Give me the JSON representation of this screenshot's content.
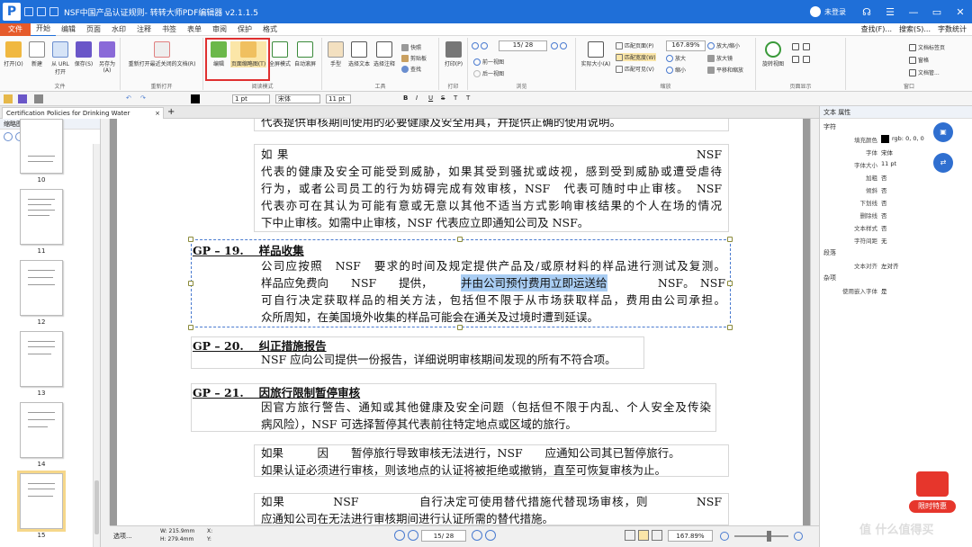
{
  "window": {
    "title": "NSF中国产品认证规则- 转转大师PDF编辑器 v2.1.1.5",
    "user": "未登录"
  },
  "menu": {
    "tabs": [
      "文件",
      "开始",
      "编辑",
      "页面",
      "水印",
      "注释",
      "书签",
      "表单",
      "审阅",
      "保护",
      "格式"
    ],
    "right": [
      "查找(F)...",
      "搜索(S)...",
      "字数统计"
    ]
  },
  "ribbon": {
    "buttons": {
      "open": "打开(O)",
      "new": "新建",
      "from_url": "从 URL 打开",
      "save": "保存(S)",
      "save_as": "另存为(A)",
      "reopen": "重新打开最近关闭的文档(R)",
      "edit": "编辑",
      "page_thumbs": "页面缩略图(T)",
      "fullscreen": "全屏模式",
      "auto_scroll": "自动滚屏",
      "hand": "手型",
      "select_text": "选择文本",
      "select_annot": "选择注释",
      "snapshot": "快照",
      "clipboard": "剪贴板",
      "find": "查找",
      "print": "打印(P)",
      "prev_view": "前一视图",
      "next_view": "后一视图",
      "actual_size": "实际大小(A)",
      "fit_page": "匹配页面(P)",
      "fit_width": "匹配宽度(W)",
      "fit_visible": "匹配可见(V)",
      "zoom": "放大/缩小",
      "zoom_in": "放大",
      "zoom_out": "缩小",
      "magnify": "放大镜",
      "pan_zoom": "平移和缩放",
      "rotate_view": "旋转视图",
      "doc_tab": "文档标签页",
      "window_menu": "窗格",
      "doc_manage": "文档管..."
    },
    "page_value": "15",
    "page_total": "/ 28",
    "zoom_value": "167.89%",
    "groups": [
      "文件",
      "重新打开",
      "阅读模式",
      "工具",
      "打印",
      "浏览",
      "缩放",
      "页面显示",
      "窗口"
    ]
  },
  "format_bar": {
    "line_width": "1 pt",
    "font": "宋体",
    "size": "11 pt",
    "styles": [
      "B",
      "I",
      "U",
      "S",
      "T",
      "T"
    ]
  },
  "doc_tab": {
    "title": "Certification Policies for Drinking Water Treatme...",
    "close": "×",
    "add": "+"
  },
  "thumbnails": {
    "panel_title": "缩略图",
    "pages": [
      "10",
      "11",
      "12",
      "13",
      "14",
      "15"
    ],
    "selected": "15"
  },
  "document": {
    "top_cut": "代表提供审核期间使用的必要健康及安全用具，并提供正确的使用说明。",
    "block1": [
      "如果　　　　　　　　　　　　　　　　　　　　　　　　　NSF",
      "代表的健康及安全可能受到威胁，如果其受到骚扰或歧视，感到受到威胁或遭受虐待",
      "行为，或者公司员工的行为妨碍完成有效审核，NSF　代表可随时中止审核。　NSF",
      "代表亦可在其认为可能有意或无意以其他不适当方式影响审核结果的个人在场的情况",
      "下中止审核。如需中止审核，NSF 代表应立即通知公司及 NSF。"
    ],
    "gp19_heading": "GP – 19.　 样品收集",
    "gp19_lines": [
      "公司应按照　NSF　要求的时间及规定提供产品及/或原材料的样品进行测试及复测。",
      "样品应免费向　　NSF　　提供，",
      "并由公司预付费用立即运送给",
      "　　NSF。　NSF",
      "可自行决定获取样品的相关方法，包括但不限于从市场获取样品，费用由公司承担。",
      "众所周知，在美国境外收集的样品可能会在通关及过境时遭到延误。"
    ],
    "gp20_heading": "GP – 20.　 纠正措施报告",
    "gp20_line": "NSF 应向公司提供一份报告，详细说明审核期间发现的所有不符合项。",
    "gp21_heading": "GP – 21.　 因旅行限制暂停审核",
    "gp21_lines": [
      "因官方旅行警告、通知或其他健康及安全问题（包括但不限于内乱、个人安全及传染",
      "病风险），NSF 可选择暂停其代表前往特定地点或区域的旅行。"
    ],
    "block2": [
      "如果　　　因　　暂停旅行导致审核无法进行，NSF　　应通知公司其已暂停旅行。",
      "如果认证必须进行审核，则该地点的认证将被拒绝或撤销，直至可恢复审核为止。"
    ],
    "block3": [
      "如果　　　　NSF　　　　　自行决定可使用替代措施代替现场审核，则　　　　NSF",
      "应通知公司在无法进行审核期间进行认证所需的替代措施。"
    ]
  },
  "status": {
    "tool": "选项...",
    "width": "W: 215.9mm",
    "height": "H: 279.4mm",
    "x": "X:",
    "y": "Y:",
    "page": "15",
    "page_total": "/ 28",
    "zoom": "167.89%"
  },
  "properties": {
    "title": "文本 属性",
    "section_font": "字符",
    "rows": [
      {
        "k": "填充颜色",
        "v": "rgb: 0, 0, 0"
      },
      {
        "k": "字体",
        "v": "宋体"
      },
      {
        "k": "字体大小",
        "v": "11 pt"
      },
      {
        "k": "加粗",
        "v": "否"
      },
      {
        "k": "倾斜",
        "v": "否"
      },
      {
        "k": "下划线",
        "v": "否"
      },
      {
        "k": "删除线",
        "v": "否"
      },
      {
        "k": "文本样式",
        "v": "否"
      },
      {
        "k": "字符间距",
        "v": "无"
      }
    ],
    "section_para": "段落",
    "align_k": "文本对齐",
    "align_v": "左对齐",
    "section_misc": "杂项",
    "embed_k": "使用嵌入字体",
    "embed_v": "是"
  },
  "promo": "限时特惠",
  "watermark": "值 什么值得买",
  "colors": {
    "brand": "#1f6fd8",
    "highlight": "#e03030",
    "selection": "#a9cdf3"
  }
}
